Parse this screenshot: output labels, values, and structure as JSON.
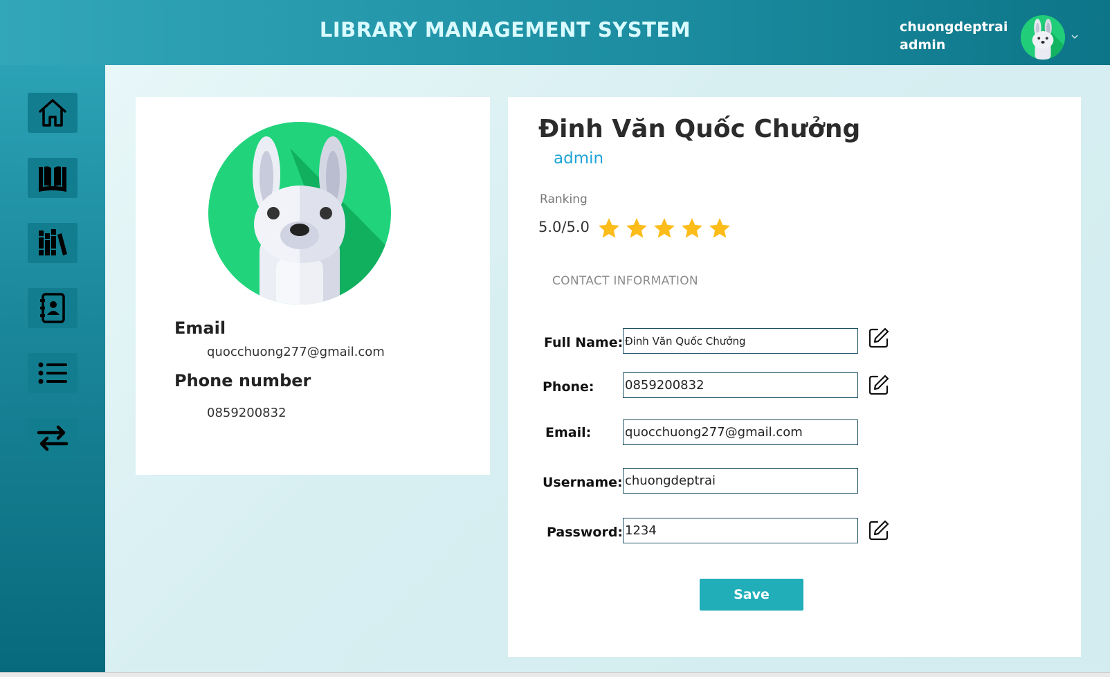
{
  "header": {
    "title": "LIBRARY MANAGEMENT SYSTEM",
    "username": "chuongdeptrai",
    "role": "admin"
  },
  "sidebar": {
    "items": [
      {
        "icon": "home-icon"
      },
      {
        "icon": "book-icon"
      },
      {
        "icon": "library-books-icon"
      },
      {
        "icon": "contacts-book-icon"
      },
      {
        "icon": "list-icon"
      },
      {
        "icon": "swap-arrows-icon"
      }
    ]
  },
  "profile_card": {
    "email_label": "Email",
    "email_value": "quocchuong277@gmail.com",
    "phone_label": "Phone number",
    "phone_value": "0859200832"
  },
  "details": {
    "name": "Đinh Văn Quốc Chưởng",
    "role": "admin",
    "ranking_label": "Ranking",
    "ranking_value": "5.0/5.0",
    "rating": 5,
    "rating_max": 5,
    "section_title": "CONTACT INFORMATION"
  },
  "form": {
    "full_name_label": "Full Name:",
    "full_name_value": "Đinh Văn Quốc Chưởng",
    "phone_label": "Phone:",
    "phone_value": "0859200832",
    "email_label": "Email:",
    "email_value": "quocchuong277@gmail.com",
    "username_label": "Username:",
    "username_value": "chuongdeptrai",
    "password_label": "Password:",
    "password_value": "1234",
    "save_label": "Save"
  },
  "colors": {
    "header_start": "#32a7b9",
    "header_end": "#0d7588",
    "accent_button": "#21aeb9",
    "role_text": "#1ea3d6",
    "star": "#fcbc1a",
    "avatar_green": "#21cd78"
  }
}
